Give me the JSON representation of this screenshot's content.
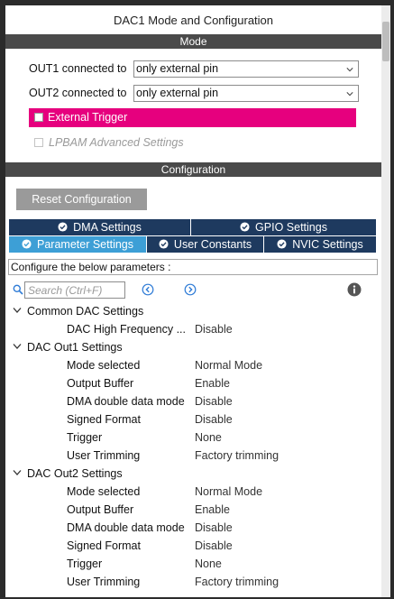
{
  "window": {
    "title": "DAC1 Mode and Configuration"
  },
  "mode": {
    "header": "Mode",
    "out1": {
      "label": "OUT1 connected to",
      "value": "only external pin"
    },
    "out2": {
      "label": "OUT2 connected to",
      "value": "only external pin"
    },
    "external_trigger": {
      "label": "External Trigger",
      "checked": false
    },
    "lpbam": {
      "label": "LPBAM Advanced Settings",
      "checked": false,
      "disabled": true
    }
  },
  "configuration": {
    "header": "Configuration",
    "reset_label": "Reset Configuration",
    "tabs_row1": [
      {
        "label": "DMA Settings"
      },
      {
        "label": "GPIO Settings"
      }
    ],
    "tabs_row2": [
      {
        "label": "Parameter Settings",
        "active": true
      },
      {
        "label": "User Constants"
      },
      {
        "label": "NVIC Settings"
      }
    ],
    "description": "Configure the below parameters :",
    "search_placeholder": "Search (Ctrl+F)"
  },
  "tree": {
    "common": {
      "label": "Common DAC Settings",
      "params": [
        {
          "name": "DAC High Frequency ...",
          "value": "Disable"
        }
      ]
    },
    "out1": {
      "label": "DAC Out1 Settings",
      "params": [
        {
          "name": "Mode selected",
          "value": "Normal Mode"
        },
        {
          "name": "Output Buffer",
          "value": "Enable"
        },
        {
          "name": "DMA double data mode",
          "value": "Disable"
        },
        {
          "name": "Signed Format",
          "value": "Disable"
        },
        {
          "name": "Trigger",
          "value": "None"
        },
        {
          "name": "User Trimming",
          "value": "Factory trimming"
        }
      ]
    },
    "out2": {
      "label": "DAC Out2 Settings",
      "params": [
        {
          "name": "Mode selected",
          "value": "Normal Mode"
        },
        {
          "name": "Output Buffer",
          "value": "Enable"
        },
        {
          "name": "DMA double data mode",
          "value": "Disable"
        },
        {
          "name": "Signed Format",
          "value": "Disable"
        },
        {
          "name": "Trigger",
          "value": "None"
        },
        {
          "name": "User Trimming",
          "value": "Factory trimming"
        }
      ]
    }
  },
  "colors": {
    "section_bar": "#4a4a4a",
    "trigger_highlight": "#e6007e",
    "tab_dark": "#1e3a5f",
    "tab_active": "#3d9fd6",
    "button_gray": "#9a9a9a"
  }
}
